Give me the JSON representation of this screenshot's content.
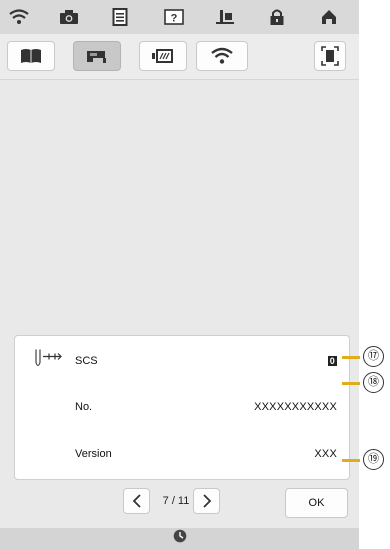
{
  "topbar": {
    "icons": [
      "wifi-icon",
      "camera-icon",
      "document-icon",
      "help-icon",
      "thread-icon",
      "lock-icon",
      "home-icon"
    ]
  },
  "toolbar": {
    "buttons": [
      "book-icon",
      "machine-icon",
      "embroidery-icon",
      "wifi-icon",
      "frame-icon"
    ],
    "active_index": 1
  },
  "info": {
    "rows": [
      {
        "icon": "needle-stitch-icon",
        "label": "SCS",
        "value": "0",
        "callout": "⑰"
      },
      {
        "label": "No.",
        "value": "XXXXXXXXXXX",
        "callout": "⑱"
      },
      {
        "label": "Version",
        "value": "XXX",
        "callout": "⑲"
      }
    ]
  },
  "pager": {
    "current": "7",
    "total": "11",
    "text": "7 / 11",
    "ok_label": "OK"
  },
  "colors": {
    "callout_line": "#e2ac1d",
    "screen_bg": "#e9e9e9",
    "active_button": "#c8c8c8"
  }
}
